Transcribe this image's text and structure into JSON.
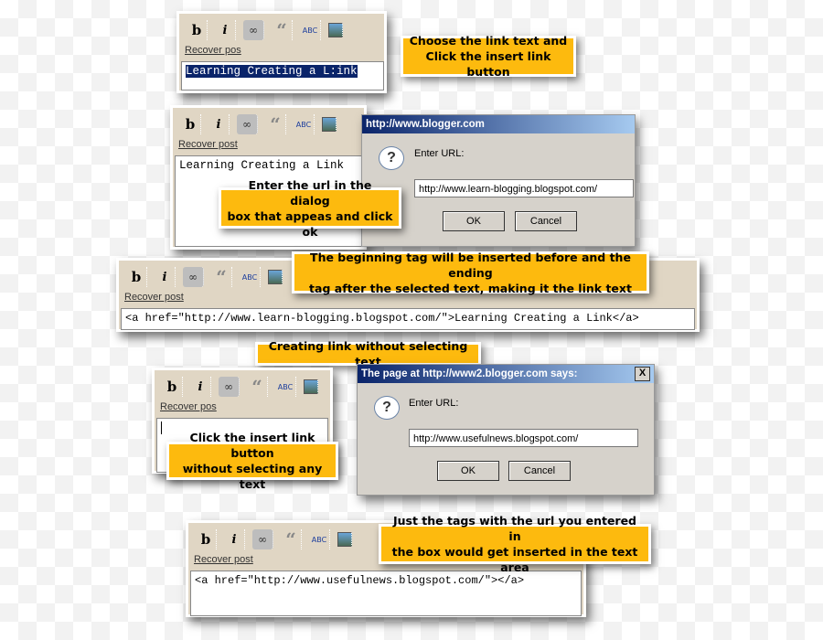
{
  "toolbar": {
    "bold": "b",
    "italic": "i",
    "link_icon": "link-icon",
    "quote_icon": "quote-icon",
    "spell_label": "ABC",
    "image_icon": "image-icon",
    "recover": "Recover post",
    "recover_cut": "Recover pos"
  },
  "step1": {
    "text": "Learning Creating a L:ink",
    "callout": [
      "Choose the link text and",
      "Click the insert link button"
    ]
  },
  "step2": {
    "text": "Learning Creating a Link",
    "callout": [
      "Enter the url in the dialog",
      "box that appeas and click ok"
    ],
    "dialog": {
      "title": "http://www.blogger.com",
      "prompt": "Enter URL:",
      "value": "http://www.learn-blogging.blogspot.com/",
      "ok": "OK",
      "cancel": "Cancel"
    }
  },
  "step3": {
    "callout": [
      "The beginning tag will be inserted before and the ending",
      "tag after the selected text, making it the link text"
    ],
    "text": "<a href=\"http://www.learn-blogging.blogspot.com/\">Learning Creating a Link</a>"
  },
  "step4": {
    "heading": "Creating link without selecting text",
    "callout": [
      "Click the insert link button",
      "without selecting any text"
    ],
    "dialog": {
      "title": "The page at http://www2.blogger.com says:",
      "close": "X",
      "prompt": "Enter URL:",
      "value": "http://www.usefulnews.blogspot.com/",
      "ok": "OK",
      "cancel": "Cancel"
    }
  },
  "step5": {
    "callout": [
      "Just the tags with the url you entered in",
      "the box would get inserted in the text area"
    ],
    "text": "<a href=\"http://www.usefulnews.blogspot.com/\"></a>"
  },
  "colors": {
    "callout": "#fdba0e",
    "toolbar": "#e0d6c4",
    "selection": "#0a246a",
    "dialog_title": "#0a246a"
  }
}
